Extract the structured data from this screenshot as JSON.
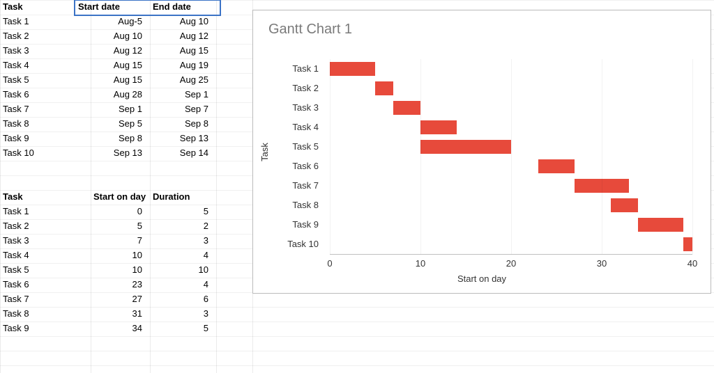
{
  "columns": {
    "A": 0,
    "Aw": 130,
    "B": 130,
    "Bw": 85,
    "C": 215,
    "Cw": 95,
    "D": 310,
    "Dw": 52
  },
  "table1": {
    "headers": [
      "Task",
      "Start date",
      "End date"
    ],
    "rows": [
      {
        "task": "Task 1",
        "start": "Aug-5",
        "end": "Aug 10"
      },
      {
        "task": "Task 2",
        "start": "Aug 10",
        "end": "Aug 12"
      },
      {
        "task": "Task 3",
        "start": "Aug 12",
        "end": "Aug 15"
      },
      {
        "task": "Task 4",
        "start": "Aug 15",
        "end": "Aug 19"
      },
      {
        "task": "Task 5",
        "start": "Aug 15",
        "end": "Aug 25"
      },
      {
        "task": "Task 6",
        "start": "Aug 28",
        "end": "Sep 1"
      },
      {
        "task": "Task 7",
        "start": "Sep 1",
        "end": "Sep 7"
      },
      {
        "task": "Task 8",
        "start": "Sep 5",
        "end": "Sep 8"
      },
      {
        "task": "Task 9",
        "start": "Sep 8",
        "end": "Sep 13"
      },
      {
        "task": "Task 10",
        "start": "Sep 13",
        "end": "Sep 14"
      }
    ]
  },
  "table2": {
    "headers": [
      "Task",
      "Start on day",
      "Duration"
    ],
    "rows": [
      {
        "task": "Task 1",
        "start": 0,
        "dur": 5
      },
      {
        "task": "Task 2",
        "start": 5,
        "dur": 2
      },
      {
        "task": "Task 3",
        "start": 7,
        "dur": 3
      },
      {
        "task": "Task 4",
        "start": 10,
        "dur": 4
      },
      {
        "task": "Task 5",
        "start": 10,
        "dur": 10
      },
      {
        "task": "Task 6",
        "start": 23,
        "dur": 4
      },
      {
        "task": "Task 7",
        "start": 27,
        "dur": 6
      },
      {
        "task": "Task 8",
        "start": 31,
        "dur": 3
      },
      {
        "task": "Task 9",
        "start": 34,
        "dur": 5
      }
    ]
  },
  "chart_data": {
    "type": "bar",
    "orientation": "horizontal",
    "title": "Gantt Chart 1",
    "xlabel": "Start on day",
    "ylabel": "Task",
    "xlim": [
      0,
      40
    ],
    "xticks": [
      0,
      10,
      20,
      30,
      40
    ],
    "categories": [
      "Task 1",
      "Task 2",
      "Task 3",
      "Task 4",
      "Task 5",
      "Task 6",
      "Task 7",
      "Task 8",
      "Task 9",
      "Task 10"
    ],
    "series": [
      {
        "name": "Start on day",
        "role": "offset",
        "values": [
          0,
          5,
          7,
          10,
          10,
          23,
          27,
          31,
          34,
          39
        ]
      },
      {
        "name": "Duration",
        "role": "span",
        "color": "#e74a3b",
        "values": [
          5,
          2,
          3,
          4,
          10,
          4,
          6,
          3,
          5,
          1
        ]
      }
    ]
  }
}
